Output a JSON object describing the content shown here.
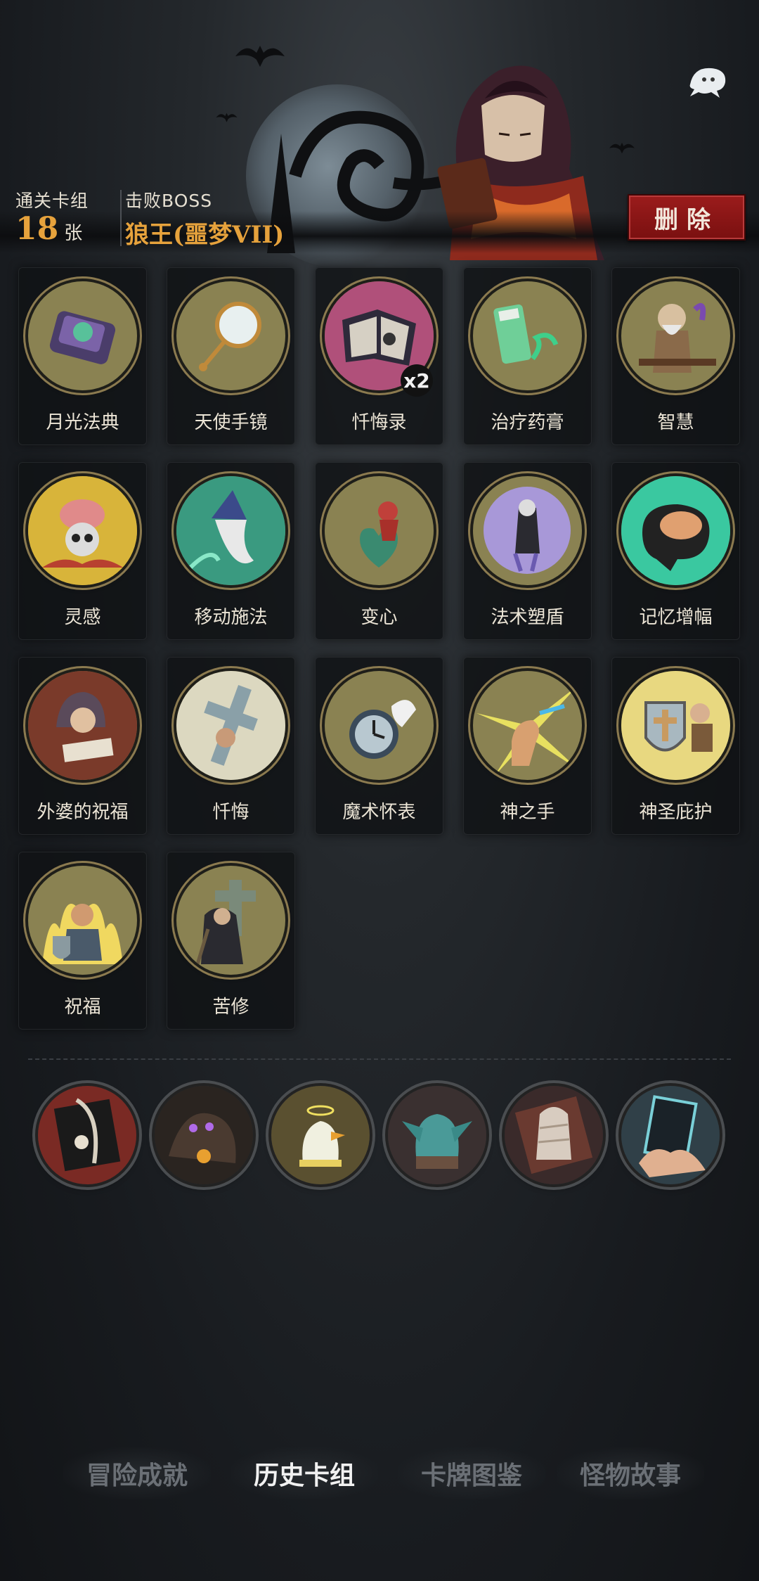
{
  "header": {
    "deck_label": "通关卡组",
    "deck_count": "18",
    "deck_unit": "张",
    "boss_label": "击败BOSS",
    "boss_name": "狼王(噩梦VII)",
    "delete_label": "删除"
  },
  "cards": [
    {
      "name": "月光法典",
      "icon": "moonlight-codex-icon"
    },
    {
      "name": "天使手镜",
      "icon": "angel-mirror-icon"
    },
    {
      "name": "忏悔录",
      "icon": "confession-book-icon",
      "badge": "x2"
    },
    {
      "name": "治疗药膏",
      "icon": "healing-ointment-icon"
    },
    {
      "name": "智慧",
      "icon": "wisdom-icon"
    },
    {
      "name": "灵感",
      "icon": "inspiration-icon"
    },
    {
      "name": "移动施法",
      "icon": "mobile-casting-icon"
    },
    {
      "name": "变心",
      "icon": "change-of-heart-icon"
    },
    {
      "name": "法术塑盾",
      "icon": "spell-shield-icon"
    },
    {
      "name": "记忆增幅",
      "icon": "memory-boost-icon"
    },
    {
      "name": "外婆的祝福",
      "icon": "grandma-blessing-icon"
    },
    {
      "name": "忏悔",
      "icon": "repentance-icon"
    },
    {
      "name": "魔术怀表",
      "icon": "magic-pocket-watch-icon"
    },
    {
      "name": "神之手",
      "icon": "hand-of-god-icon"
    },
    {
      "name": "神圣庇护",
      "icon": "holy-protection-icon"
    },
    {
      "name": "祝福",
      "icon": "blessing-icon"
    },
    {
      "name": "苦修",
      "icon": "penance-icon"
    }
  ],
  "relics": [
    {
      "icon": "pirate-flag-relic-icon",
      "color": "#b3322c"
    },
    {
      "icon": "shadow-beast-relic-icon",
      "color": "#6d4aa8"
    },
    {
      "icon": "angel-duck-relic-icon",
      "color": "#d9c046"
    },
    {
      "icon": "stone-gargoyle-relic-icon",
      "color": "#4aa3a0"
    },
    {
      "icon": "wrapped-mummy-relic-icon",
      "color": "#c9b8ad"
    },
    {
      "icon": "torn-card-hand-relic-icon",
      "color": "#4fb7c0"
    }
  ],
  "nav": [
    {
      "label": "冒险成就",
      "active": false
    },
    {
      "label": "历史卡组",
      "active": true
    },
    {
      "label": "卡牌图鉴",
      "active": false
    },
    {
      "label": "怪物故事",
      "active": false
    }
  ],
  "colors": {
    "accent_gold": "#e6a23c",
    "delete_red": "#8a1616",
    "card_medallion": "#8a8252"
  }
}
